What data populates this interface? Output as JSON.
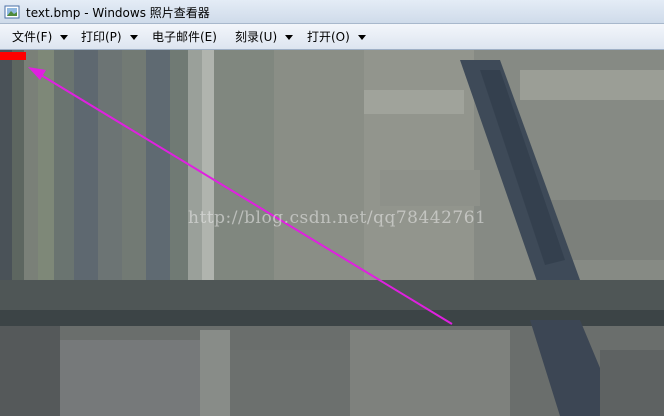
{
  "window": {
    "title": "text.bmp - Windows 照片查看器"
  },
  "menu": [
    {
      "label": "文件(F)",
      "has_dropdown": true
    },
    {
      "label": "打印(P)",
      "has_dropdown": true
    },
    {
      "label": "电子邮件(E)",
      "has_dropdown": false
    },
    {
      "label": "刻录(U)",
      "has_dropdown": true
    },
    {
      "label": "打开(O)",
      "has_dropdown": true
    }
  ],
  "viewer": {
    "watermark": "http://blog.csdn.net/qq78442761",
    "annotation_color": "#e020e0",
    "highlight_color": "#ff0000"
  }
}
